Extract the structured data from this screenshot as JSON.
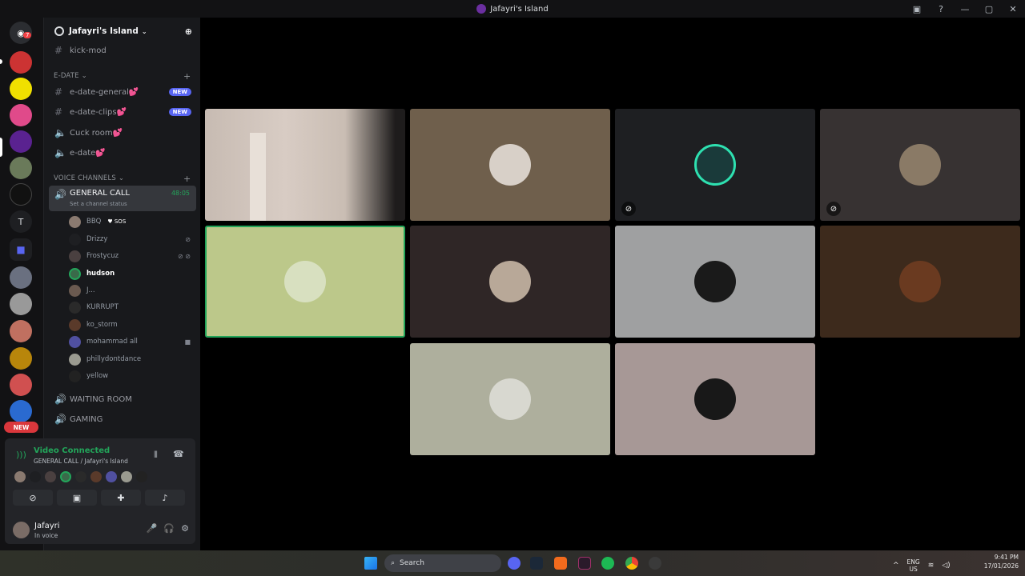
{
  "window": {
    "title": "Jafayri's Island",
    "controls": [
      "—",
      "▢",
      "✕"
    ]
  },
  "rail": {
    "discord_badge": "7",
    "new_label": "NEW",
    "text_server": "T"
  },
  "guild": {
    "name": "Jafayri's Island"
  },
  "channels": {
    "top": [
      {
        "name": "kick-mod"
      }
    ],
    "edate_category": "E-DATE",
    "edate": [
      {
        "name": "e-date-general💕",
        "badge": "NEW",
        "type": "text"
      },
      {
        "name": "e-date-clips💕",
        "badge": "NEW",
        "type": "text"
      },
      {
        "name": "Cuck room💕",
        "badge": "",
        "type": "voice"
      },
      {
        "name": "e-date💕",
        "badge": "",
        "type": "voice"
      }
    ],
    "voice_category": "VOICE CHANNELS",
    "general_call": {
      "name": "GENERAL CALL",
      "timer": "48:05",
      "status": "Set a channel status"
    },
    "voice_users": [
      "BBQ",
      "Drizzy",
      "Frostycuz",
      "hudson",
      "J...",
      "KURRUPT",
      "ko_storm",
      "mohammad all",
      "phillydontdance",
      "yellow"
    ],
    "bbq_tag": "♥ SOS",
    "other_voice": [
      "WAITING ROOM",
      "GAMING"
    ]
  },
  "voice_panel": {
    "status": "Video Connected",
    "location": "GENERAL CALL / Jafayri's Island"
  },
  "user": {
    "name": "Jafayri",
    "status": "In voice"
  },
  "taskbar": {
    "search_placeholder": "Search",
    "lang_top": "ENG",
    "lang_bottom": "US",
    "time": "9:41 PM",
    "date": "17/01/2026"
  },
  "colors": {
    "accent": "#5865f2",
    "green": "#23a55a"
  }
}
